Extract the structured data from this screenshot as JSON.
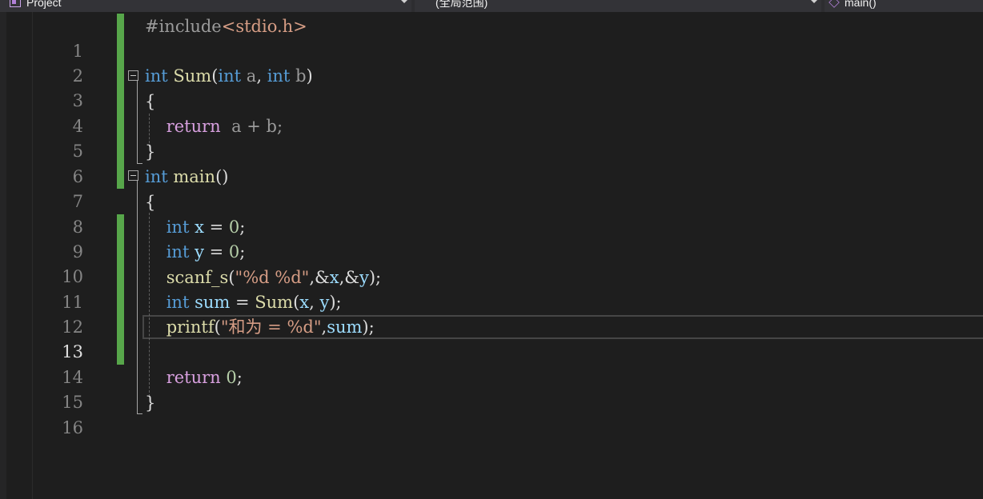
{
  "nav": {
    "project": "Project",
    "scope": "(全局范围)",
    "member": "main()"
  },
  "line_numbers": [
    "1",
    "2",
    "3",
    "4",
    "5",
    "6",
    "7",
    "8",
    "9",
    "10",
    "11",
    "12",
    "13",
    "14",
    "15",
    "16"
  ],
  "active_line": "13",
  "code": {
    "l1": {
      "directive": "#include",
      "header": "<stdio.h>"
    },
    "l3": {
      "kw_int1": "int",
      "fn_sum": "Sum",
      "open": "(",
      "kw_int2": "int",
      "param_a": "a",
      "comma": ",",
      "kw_int3": "int",
      "param_b": "b",
      "close": ")"
    },
    "l4": {
      "brace": "{"
    },
    "l5": {
      "kw_return": "return",
      "expr": "a + b;"
    },
    "l6": {
      "brace": "}"
    },
    "l7": {
      "kw_int": "int",
      "fn_main": "main",
      "parens": "()"
    },
    "l8": {
      "brace": "{"
    },
    "l9": {
      "kw_int": "int",
      "var": "x",
      "eq": " = ",
      "num": "0",
      "semi": ";"
    },
    "l10": {
      "kw_int": "int",
      "var": "y",
      "eq": " = ",
      "num": "0",
      "semi": ";"
    },
    "l11": {
      "fn": "scanf_s",
      "open": "(",
      "str": "\"%d %d\"",
      "mid1": ",&",
      "var_x": "x",
      "mid2": ",&",
      "var_y": "y",
      "close": ");"
    },
    "l12": {
      "kw_int": "int",
      "var_sum": "sum",
      "eq": " = ",
      "fn": "Sum",
      "open": "(",
      "var_x": "x",
      "comma": ", ",
      "var_y": "y",
      "close": ");"
    },
    "l13": {
      "fn": "printf",
      "open": "(",
      "str": "\"和为 = %d\"",
      "comma": ",",
      "var_sum": "sum",
      "close": ");"
    },
    "l15": {
      "kw_return": "return",
      "num": "0",
      "semi": ";"
    },
    "l16": {
      "brace": "}"
    }
  }
}
